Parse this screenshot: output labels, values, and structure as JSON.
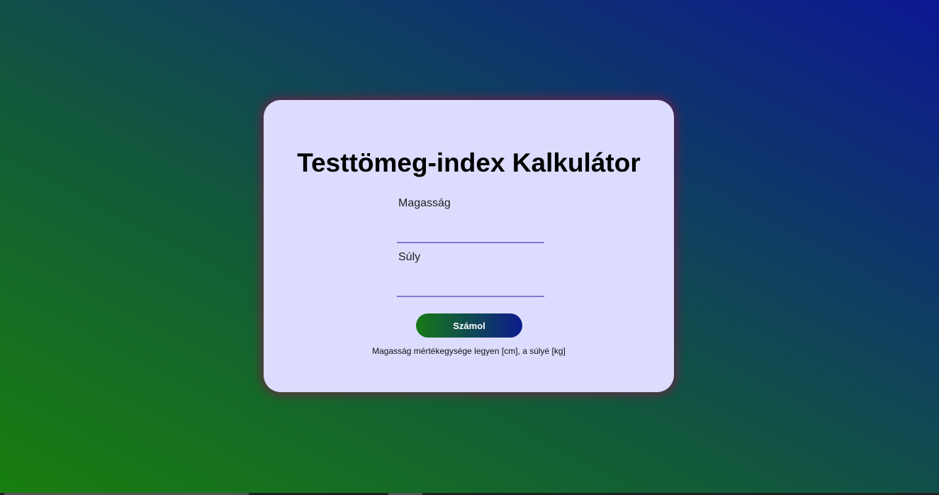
{
  "title": "Testtömeg-index Kalkulátor",
  "form": {
    "height_label": "Magasság",
    "height_value": "",
    "weight_label": "Súly",
    "weight_value": "",
    "submit_label": "Számol",
    "note": "Magasság mértékegysége legyen [cm], a súlyé [kg]"
  },
  "colors": {
    "card_bg": "#dcdcfe",
    "bg_green": "#187f0e",
    "bg_blue": "#0c1792",
    "underline": "#8478d0"
  }
}
